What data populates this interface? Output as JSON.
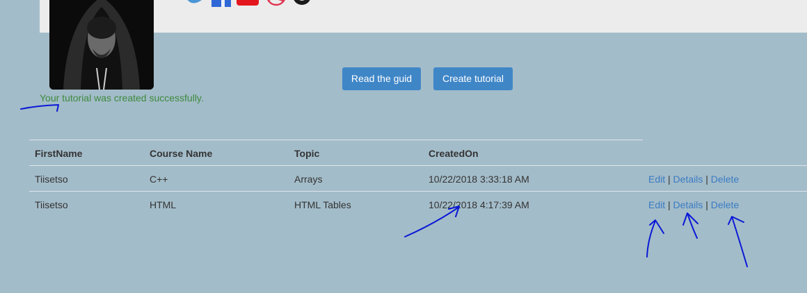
{
  "buttons": {
    "guide_label": "Read the guid",
    "create_label": "Create tutorial"
  },
  "message": {
    "success": "Your tutorial was created successfully."
  },
  "table": {
    "headers": [
      "FirstName",
      "Course Name",
      "Topic",
      "CreatedOn"
    ],
    "rows": [
      {
        "first_name": "Tiisetso",
        "course_name": "C++",
        "topic": "Arrays",
        "created_on": "10/22/2018 3:33:18 AM"
      },
      {
        "first_name": "Tiisetso",
        "course_name": "HTML",
        "topic": "HTML Tables",
        "created_on": "10/22/2018 4:17:39 AM"
      }
    ],
    "actions": {
      "edit": "Edit",
      "details": "Details",
      "delete": "Delete",
      "separator": "|"
    }
  },
  "social_icons": [
    "twitter-icon",
    "facebook-icon",
    "youtube-icon",
    "dribbble-icon",
    "github-icon"
  ],
  "colors": {
    "page_bg": "#a3bcc9",
    "topbar_bg": "#ececec",
    "button_bg": "#3f86c7",
    "success_text": "#3d8a3d",
    "link": "#3a7bc4",
    "annotation_ink": "#0a19d6"
  }
}
